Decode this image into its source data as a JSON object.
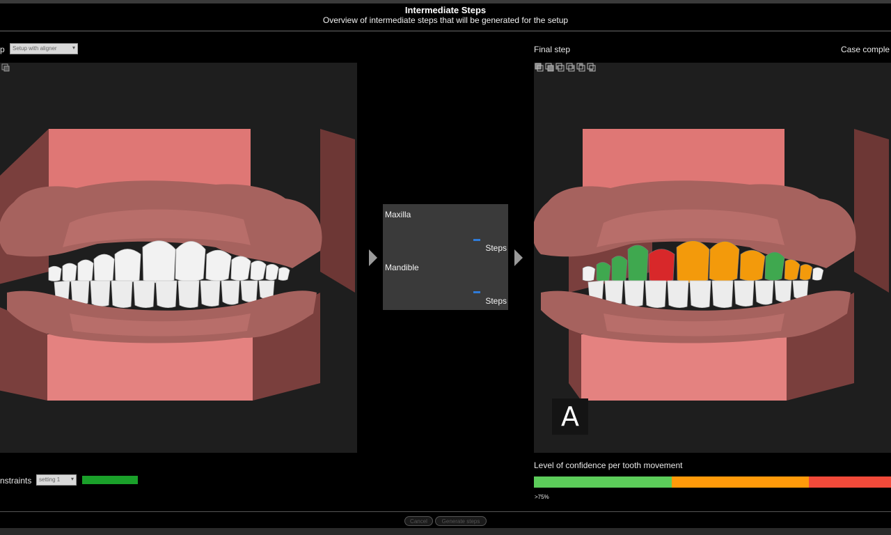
{
  "header": {
    "title": "Intermediate Steps",
    "subtitle": "Overview of intermediate steps that will be generated for the setup"
  },
  "left": {
    "label": "p",
    "setup_select": "Setup with aligner",
    "constraints_label": "nstraints",
    "setting_select": "setting 1",
    "constraint_color": "#1aa02a"
  },
  "middle": {
    "maxilla_label": "Maxilla",
    "maxilla_steps": "Steps",
    "mandible_label": "Mandible",
    "mandible_steps": "Steps"
  },
  "right": {
    "label": "Final step",
    "case_status": "Case comple",
    "badge": "A",
    "toolbar_icons": [
      "view-front-icon",
      "view-top-icon",
      "view-left-icon",
      "view-right-icon",
      "view-back-icon",
      "view-bottom-icon"
    ]
  },
  "confidence": {
    "title": "Level of confidence per tooth movement",
    "low_label": ">75%",
    "segments": [
      {
        "name": "high",
        "color": "#5ccc5a",
        "share": 0.385
      },
      {
        "name": "medium",
        "color": "#ff9a0a",
        "share": 0.385
      },
      {
        "name": "low",
        "color": "#f24a3a",
        "share": 0.23
      }
    ]
  },
  "footer": {
    "cancel": "Cancel",
    "generate": "Generate steps"
  },
  "colors": {
    "gum": "#a6625e",
    "base": "#e07a78",
    "tooth": "#f2f2f2",
    "tooth_green": "#3fa84f",
    "tooth_orange": "#f39a0b",
    "tooth_red": "#d8282a"
  }
}
